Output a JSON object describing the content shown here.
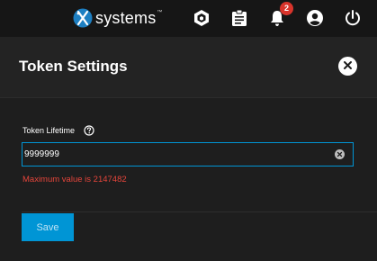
{
  "topbar": {
    "brand_text": "systems",
    "brand_tm": "™",
    "icons": [
      "truecommand-icon",
      "task-manager-icon",
      "bell-icon",
      "account-circle-icon",
      "power-icon"
    ],
    "alerts_count": "2"
  },
  "dialog": {
    "title": "Token Settings",
    "field_label": "Token Lifetime",
    "field_value": "9999999",
    "error_text": "Maximum value is 2147482",
    "save_label": "Save"
  },
  "colors": {
    "accent": "#0095d5",
    "error": "#e5453b",
    "badge": "#d9342b",
    "topbar_bg": "#161616",
    "panel_bg": "#1e1e1e"
  }
}
